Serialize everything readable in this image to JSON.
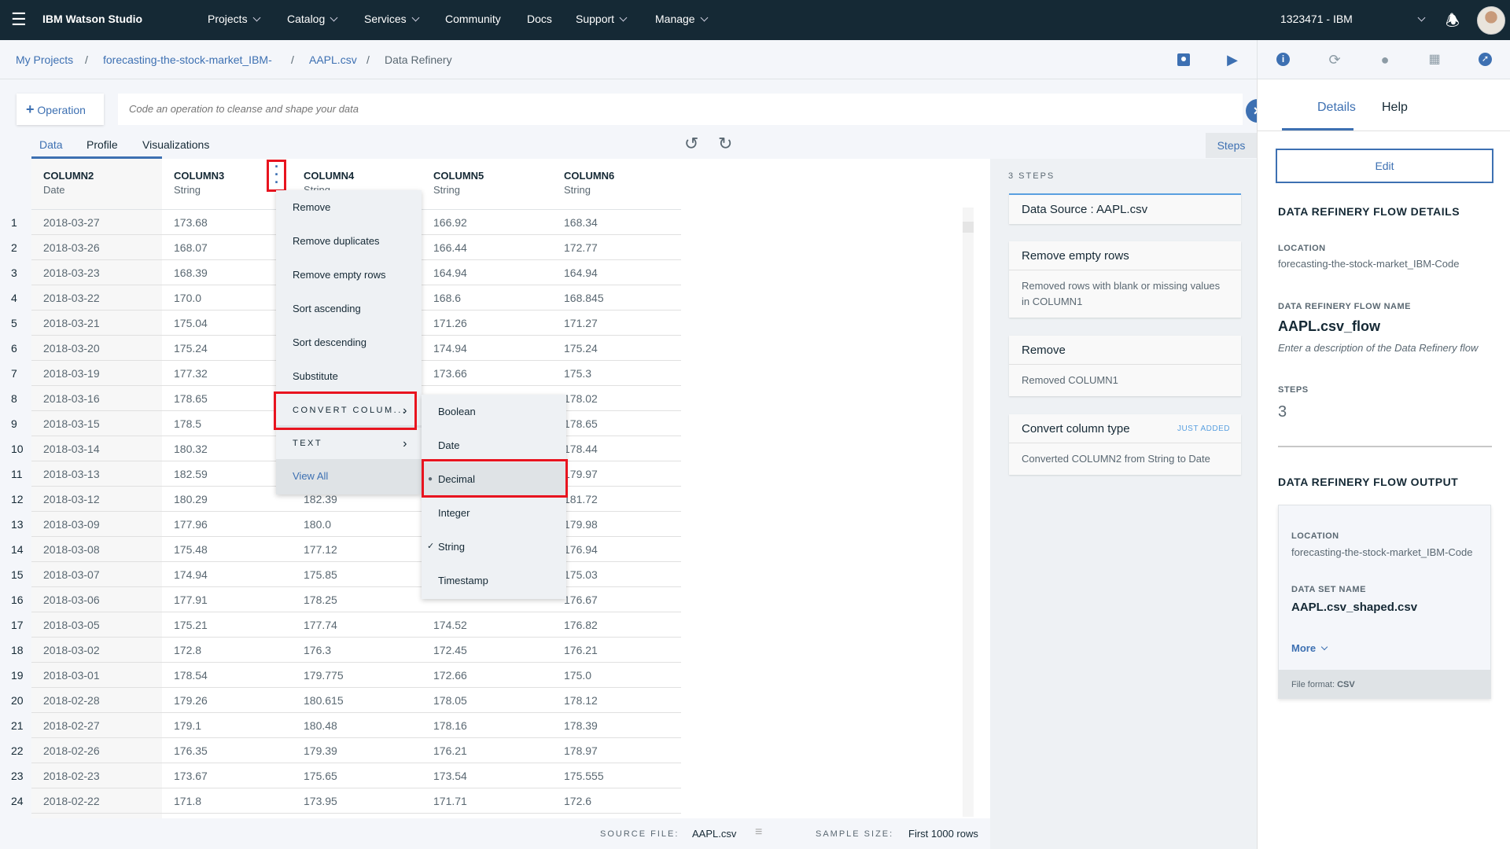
{
  "topbar": {
    "app_title": "IBM Watson Studio",
    "nav": [
      "Projects",
      "Catalog",
      "Services",
      "Community",
      "Docs",
      "Support",
      "Manage"
    ],
    "account": "1323471 - IBM"
  },
  "breadcrumb": [
    "My Projects",
    "forecasting-the-stock-market_IBM-",
    "AAPL.csv",
    "Data Refinery"
  ],
  "breadcrumb_sep": "/",
  "operation_label": "Operation",
  "code_placeholder": "Code an operation to cleanse and shape your data",
  "tabs": [
    "Data",
    "Profile",
    "Visualizations"
  ],
  "steps_button": "Steps",
  "columns": [
    {
      "name": "COLUMN2",
      "type": "Date"
    },
    {
      "name": "COLUMN3",
      "type": "String"
    },
    {
      "name": "COLUMN4",
      "type": "String"
    },
    {
      "name": "COLUMN5",
      "type": "String"
    },
    {
      "name": "COLUMN6",
      "type": "String"
    }
  ],
  "rows": [
    [
      "1",
      "2018-03-27",
      "173.68",
      "",
      "166.92",
      "168.34"
    ],
    [
      "2",
      "2018-03-26",
      "168.07",
      "",
      "166.44",
      "172.77"
    ],
    [
      "3",
      "2018-03-23",
      "168.39",
      "",
      "164.94",
      "164.94"
    ],
    [
      "4",
      "2018-03-22",
      "170.0",
      "",
      "168.6",
      "168.845"
    ],
    [
      "5",
      "2018-03-21",
      "175.04",
      "",
      "171.26",
      "171.27"
    ],
    [
      "6",
      "2018-03-20",
      "175.24",
      "",
      "174.94",
      "175.24"
    ],
    [
      "7",
      "2018-03-19",
      "177.32",
      "",
      "173.66",
      "175.3"
    ],
    [
      "8",
      "2018-03-16",
      "178.65",
      "",
      "",
      "178.02"
    ],
    [
      "9",
      "2018-03-15",
      "178.5",
      "",
      "",
      "178.65"
    ],
    [
      "10",
      "2018-03-14",
      "180.32",
      "",
      "",
      "178.44"
    ],
    [
      "11",
      "2018-03-13",
      "182.59",
      "",
      "",
      "179.97"
    ],
    [
      "12",
      "2018-03-12",
      "180.29",
      "182.39",
      "",
      "181.72"
    ],
    [
      "13",
      "2018-03-09",
      "177.96",
      "180.0",
      "",
      "179.98"
    ],
    [
      "14",
      "2018-03-08",
      "175.48",
      "177.12",
      "",
      "176.94"
    ],
    [
      "15",
      "2018-03-07",
      "174.94",
      "175.85",
      "",
      "175.03"
    ],
    [
      "16",
      "2018-03-06",
      "177.91",
      "178.25",
      "",
      "176.67"
    ],
    [
      "17",
      "2018-03-05",
      "175.21",
      "177.74",
      "174.52",
      "176.82"
    ],
    [
      "18",
      "2018-03-02",
      "172.8",
      "176.3",
      "172.45",
      "176.21"
    ],
    [
      "19",
      "2018-03-01",
      "178.54",
      "179.775",
      "172.66",
      "175.0"
    ],
    [
      "20",
      "2018-02-28",
      "179.26",
      "180.615",
      "178.05",
      "178.12"
    ],
    [
      "21",
      "2018-02-27",
      "179.1",
      "180.48",
      "178.16",
      "178.39"
    ],
    [
      "22",
      "2018-02-26",
      "176.35",
      "179.39",
      "176.21",
      "178.97"
    ],
    [
      "23",
      "2018-02-23",
      "173.67",
      "175.65",
      "173.54",
      "175.555"
    ],
    [
      "24",
      "2018-02-22",
      "171.8",
      "173.95",
      "171.71",
      "172.6"
    ]
  ],
  "column_menu": {
    "items": [
      "Remove",
      "Remove duplicates",
      "Remove empty rows",
      "Sort ascending",
      "Sort descending",
      "Substitute"
    ],
    "convert": "CONVERT COLUM...",
    "text": "TEXT",
    "view_all": "View All"
  },
  "convert_submenu": {
    "items": [
      "Boolean",
      "Date",
      "Decimal",
      "Integer",
      "String",
      "Timestamp"
    ],
    "hovered": "Decimal",
    "checked": "String"
  },
  "footer": {
    "source_label": "SOURCE FILE:",
    "source_value": "AAPL.csv",
    "sample_label": "SAMPLE SIZE:",
    "sample_value": "First 1000 rows"
  },
  "steps": {
    "count_label": "3 STEPS",
    "list": [
      {
        "title": "Data Source : AAPL.csv",
        "desc": ""
      },
      {
        "title": "Remove empty rows",
        "desc": "Removed rows with blank or missing values in COLUMN1"
      },
      {
        "title": "Remove",
        "desc": "Removed COLUMN1"
      },
      {
        "title": "Convert column type",
        "badge": "JUST ADDED",
        "desc": "Converted COLUMN2 from String to Date"
      }
    ]
  },
  "details": {
    "tabs": [
      "Details",
      "Help"
    ],
    "edit": "Edit",
    "flow_details_heading": "DATA REFINERY FLOW DETAILS",
    "location_label": "LOCATION",
    "location": "forecasting-the-stock-market_IBM-Code",
    "flow_name_label": "DATA REFINERY FLOW NAME",
    "flow_name": "AAPL.csv_flow",
    "description_placeholder": "Enter a description of the Data Refinery flow",
    "steps_label": "STEPS",
    "steps": "3",
    "output_heading": "DATA REFINERY FLOW OUTPUT",
    "out_location_label": "LOCATION",
    "out_location": "forecasting-the-stock-market_IBM-Code",
    "dataset_label": "DATA SET NAME",
    "dataset": "AAPL.csv_shaped.csv",
    "more": "More",
    "file_format": "File format: ",
    "file_format_value": "CSV"
  },
  "colors": {
    "topbar": "#152935",
    "accent": "#3d70b2",
    "highlight": "#e8141f"
  }
}
